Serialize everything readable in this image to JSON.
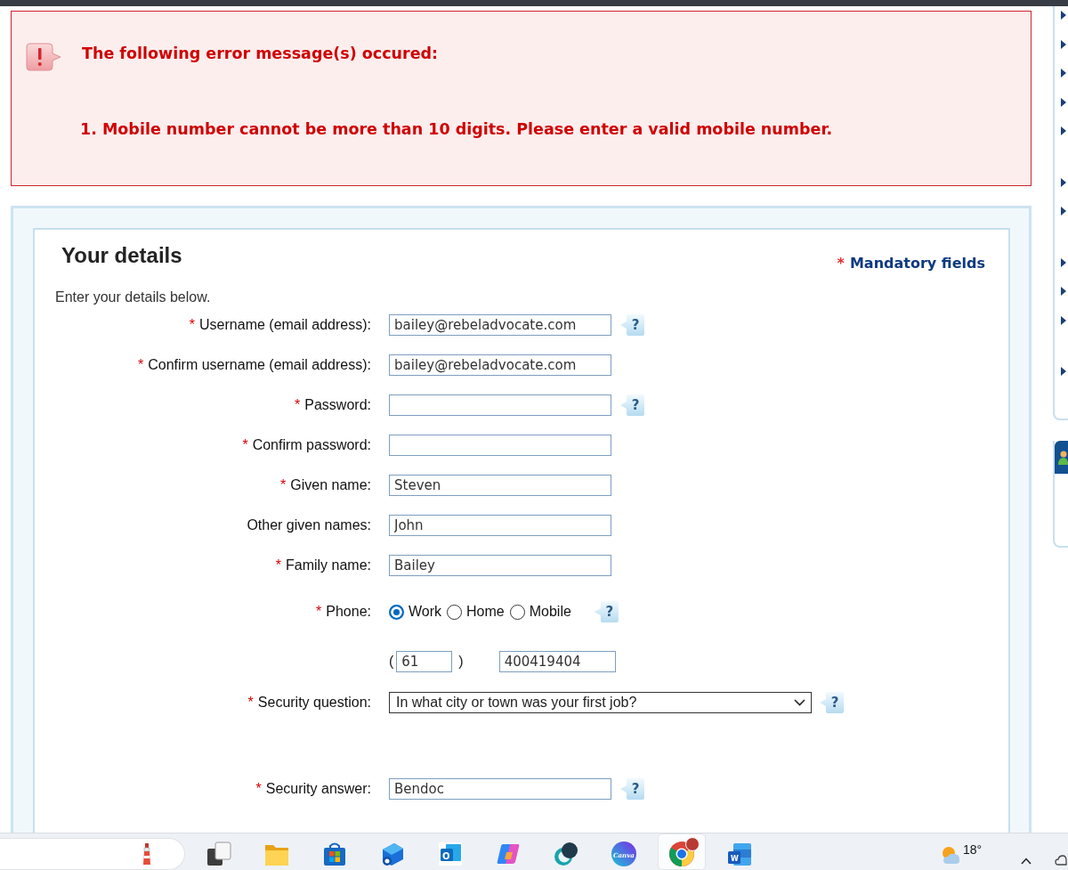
{
  "error_panel": {
    "title": "The following error message(s) occured:",
    "messages": [
      "1. Mobile number cannot be more than 10 digits. Please enter a valid mobile number."
    ]
  },
  "form": {
    "title": "Your details",
    "mandatory_note": {
      "marker": "*",
      "text": "Mandatory fields"
    },
    "intro": "Enter your details below.",
    "fields": [
      {
        "kind": "text",
        "marker": "*",
        "label": "Username (email address):",
        "value": "bailey@rebeladvocate.com",
        "help": "?"
      },
      {
        "kind": "text",
        "marker": "*",
        "label": "Confirm username (email address):",
        "value": "bailey@rebeladvocate.com"
      },
      {
        "kind": "password",
        "marker": "*",
        "label": "Password:",
        "help": "?"
      },
      {
        "kind": "password",
        "marker": "*",
        "label": "Confirm password:"
      },
      {
        "kind": "text",
        "marker": "*",
        "label": "Given name:",
        "value": "Steven"
      },
      {
        "kind": "text",
        "label": "Other given names:",
        "value": "John"
      },
      {
        "kind": "text",
        "marker": "*",
        "label": "Family name:",
        "value": "Bailey"
      },
      {
        "kind": "radio",
        "marker": "*",
        "label": "Phone:",
        "options": [
          {
            "label": "Work",
            "selected": true
          },
          {
            "label": "Home",
            "selected": false
          },
          {
            "label": "Mobile",
            "selected": false
          }
        ],
        "help": "?"
      },
      {
        "kind": "phone",
        "open": "(",
        "area_code": "61",
        "close": ")",
        "number": "400419404"
      },
      {
        "kind": "select",
        "marker": "*",
        "label": "Security question:",
        "value": "In what city or town was your first job?",
        "help": "?"
      },
      {
        "kind": "text",
        "marker": "*",
        "label": "Security answer:",
        "value": "Bendoc",
        "help": "?"
      }
    ]
  },
  "taskbar": {
    "apps": [
      {
        "kind": "task-view",
        "selected": false
      },
      {
        "kind": "folder",
        "selected": false
      },
      {
        "kind": "store",
        "selected": false
      },
      {
        "kind": "outlook-new",
        "selected": false
      },
      {
        "kind": "outlook",
        "glyph": "O",
        "selected": false
      },
      {
        "kind": "copilot",
        "selected": false
      },
      {
        "kind": "orb",
        "selected": false
      },
      {
        "kind": "canva",
        "glyph": "Canva",
        "selected": false
      },
      {
        "kind": "chrome",
        "selected": true
      },
      {
        "kind": "word",
        "glyph": "W",
        "selected": false
      }
    ],
    "weather": {
      "temperature": "18°"
    }
  }
}
